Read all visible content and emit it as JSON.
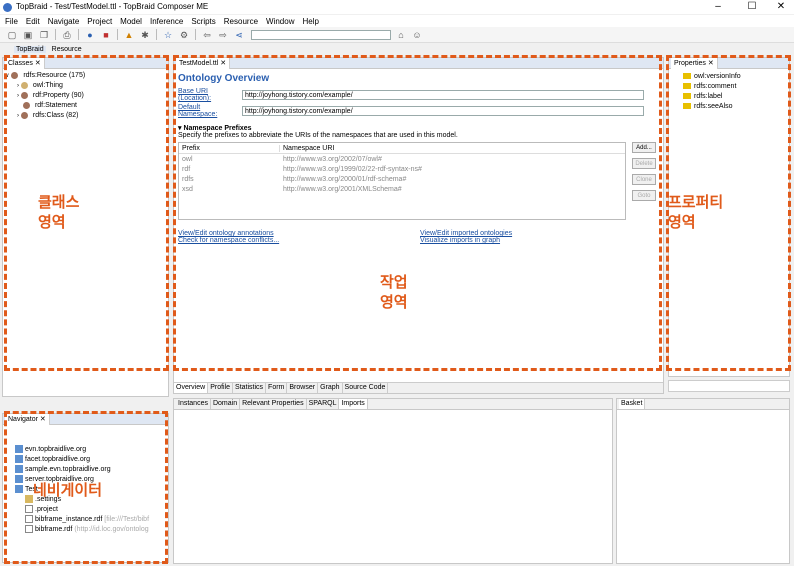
{
  "window": {
    "title": "TopBraid - Test/TestModel.ttl - TopBraid Composer ME",
    "minimize": "–",
    "maximize": "☐",
    "close": "✕"
  },
  "menu": [
    "File",
    "Edit",
    "Navigate",
    "Project",
    "Model",
    "Inference",
    "Scripts",
    "Resource",
    "Window",
    "Help"
  ],
  "perspectives": {
    "topbraid": "TopBraid",
    "resource": "Resource"
  },
  "classes": {
    "tab": "Classes",
    "root": "rdfs:Resource  (175)",
    "items": [
      "owl:Thing",
      "rdf:Property  (90)",
      "rdf:Statement",
      "rdfs:Class  (82)"
    ]
  },
  "editor": {
    "tab": "TestModel.ttl",
    "title": "Ontology Overview",
    "base_uri_label": "Base URI (Location):",
    "base_uri_value": "http://joyhong.tistory.com/example/",
    "default_ns_label": "Default Namespace:",
    "default_ns_value": "http://joyhong.tistory.com/example/",
    "ns_section": "Namespace Prefixes",
    "ns_desc": "Specify the prefixes to abbreviate the URIs of the namespaces that are used in this model.",
    "col_prefix": "Prefix",
    "col_uri": "Namespace URI",
    "ns_rows": [
      {
        "prefix": "owl",
        "uri": "http://www.w3.org/2002/07/owl#"
      },
      {
        "prefix": "rdf",
        "uri": "http://www.w3.org/1999/02/22-rdf-syntax-ns#"
      },
      {
        "prefix": "rdfs",
        "uri": "http://www.w3.org/2000/01/rdf-schema#"
      },
      {
        "prefix": "xsd",
        "uri": "http://www.w3.org/2001/XMLSchema#"
      }
    ],
    "btn_add": "Add...",
    "btn_delete": "Delete",
    "btn_clone": "Clone",
    "btn_goto": "Goto",
    "link_annotations": "View/Edit ontology annotations",
    "link_conflicts": "Check for namespace conflicts...",
    "link_imports": "View/Edit imported ontologies",
    "link_graph": "Visualize imports in graph",
    "bottom_tabs": [
      "Overview",
      "Profile",
      "Statistics",
      "Form",
      "Browser",
      "Graph",
      "Source Code"
    ]
  },
  "properties": {
    "tab": "Properties",
    "items": [
      "owl:versionInfo",
      "rdfs:comment",
      "rdfs:label",
      "rdfs:seeAlso"
    ]
  },
  "lower_tabs": [
    "Instances",
    "Domain",
    "Relevant Properties",
    "SPARQL",
    "Imports"
  ],
  "basket": {
    "tab": "Basket"
  },
  "navigator": {
    "tab": "Navigator",
    "items": [
      "evn.topbraidlive.org",
      "facet.topbraidlive.org",
      "sample.evn.topbraidlive.org",
      "server.topbraidlive.org",
      "Test",
      ".settings",
      ".project",
      "bibframe_instance.rdf",
      "bibframe.rdf"
    ],
    "item_hints": [
      "[file:///Test/bibf",
      "(http://id.loc.gov/ontolog"
    ]
  },
  "annotations": {
    "classes": "클래스\n영역",
    "properties": "프로퍼티\n영역",
    "work": "작업\n영역",
    "navigator": "네비게이터"
  },
  "colors": {
    "accent": "#e05a1a",
    "link": "#1a4fa0"
  }
}
